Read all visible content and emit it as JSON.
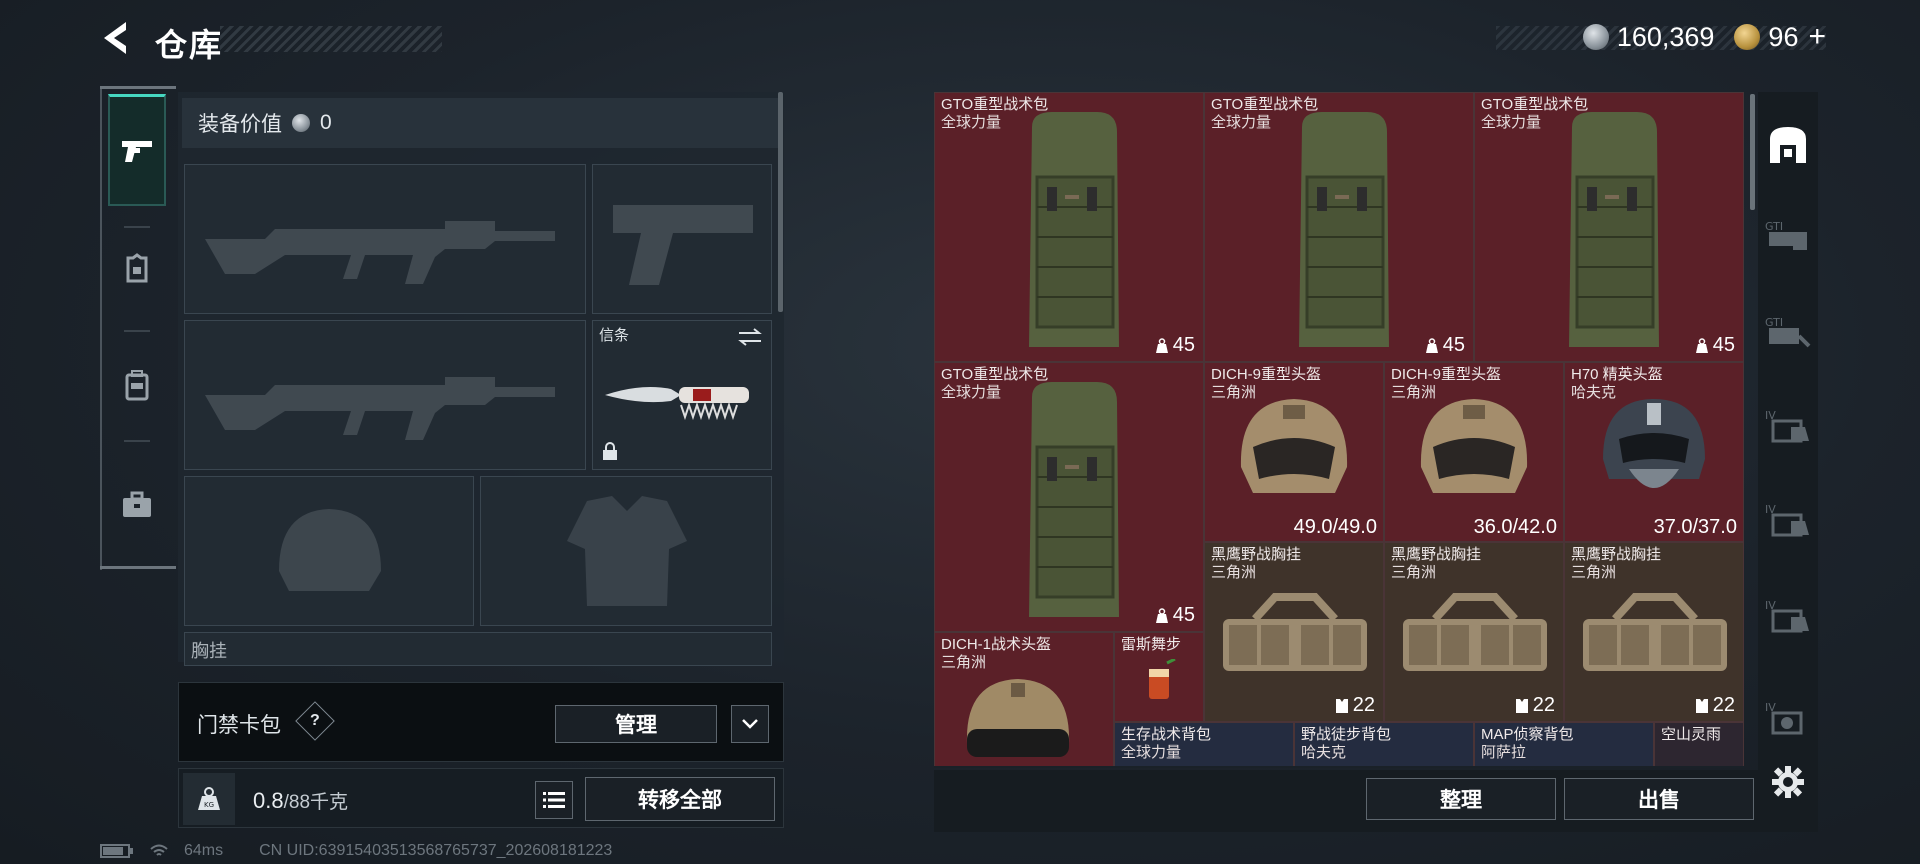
{
  "header": {
    "title": "仓库",
    "back_icon": "back-arrow-icon"
  },
  "currency": {
    "silver": "160,369",
    "gold": "96",
    "gold_plus": "+"
  },
  "rail": {
    "items": [
      {
        "name": "weapon",
        "icon": "pistol-icon",
        "active": true
      },
      {
        "name": "armor",
        "icon": "armor-icon"
      },
      {
        "name": "backpack",
        "icon": "backpack-icon"
      },
      {
        "name": "case",
        "icon": "briefcase-icon"
      }
    ]
  },
  "loadout": {
    "value_label": "装备价值",
    "value": "0",
    "slots": {
      "knife_label": "信条",
      "partial_label": "胸挂"
    },
    "access_label": "门禁卡包",
    "access_help": "?",
    "manage_label": "管理",
    "weight_current": "0.8",
    "weight_max": "/88千克",
    "transfer_label": "转移全部"
  },
  "warehouse": {
    "items": [
      {
        "name": "GTO重型战术包",
        "sub": "全球力量",
        "qty": "45",
        "kind": "backpack"
      },
      {
        "name": "GTO重型战术包",
        "sub": "全球力量",
        "qty": "45",
        "kind": "backpack"
      },
      {
        "name": "GTO重型战术包",
        "sub": "全球力量",
        "qty": "45",
        "kind": "backpack"
      },
      {
        "name": "GTO重型战术包",
        "sub": "全球力量",
        "qty": "45",
        "kind": "backpack"
      },
      {
        "name": "DICH-9重型头盔",
        "sub": "三角洲",
        "dur": "49.0/49.0"
      },
      {
        "name": "DICH-9重型头盔",
        "sub": "三角洲",
        "dur": "36.0/42.0"
      },
      {
        "name": "H70 精英头盔",
        "sub": "哈夫克",
        "dur": "37.0/37.0"
      },
      {
        "name": "黑鹰野战胸挂",
        "sub": "三角洲",
        "qty": "22"
      },
      {
        "name": "黑鹰野战胸挂",
        "sub": "三角洲",
        "qty": "22"
      },
      {
        "name": "黑鹰野战胸挂",
        "sub": "三角洲",
        "qty": "22"
      },
      {
        "name": "DICH-1战术头盔",
        "sub": "三角洲"
      },
      {
        "name": "雷斯舞步",
        "sub": ""
      },
      {
        "name": "生存战术背包",
        "sub": "全球力量"
      },
      {
        "name": "野战徒步背包",
        "sub": "哈夫克"
      },
      {
        "name": "MAP侦察背包",
        "sub": "阿萨拉"
      },
      {
        "name": "空山灵雨",
        "sub": ""
      }
    ],
    "sort_label": "整理",
    "sell_label": "出售"
  },
  "status": {
    "ping": "64ms",
    "uid": "CN UID:63915403513568765737_202608181223"
  },
  "colors": {
    "accent": "#46d6c0",
    "item_red": "#5b2028",
    "item_tan": "#3f332a"
  }
}
